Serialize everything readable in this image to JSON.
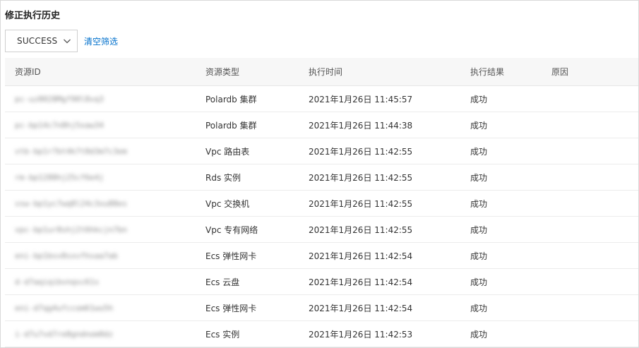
{
  "panel": {
    "title": "修正执行历史"
  },
  "filter": {
    "status_value": "SUCCESS",
    "clear_label": "清空筛选"
  },
  "table": {
    "columns": [
      "资源ID",
      "资源类型",
      "执行时间",
      "执行结果",
      "原因"
    ],
    "rows": [
      {
        "resource_id": "pc-uz8028Mgf90l8vq3",
        "type": "Polardb 集群",
        "time": "2021年1月26日 11:45:57",
        "result": "成功",
        "reason": ""
      },
      {
        "resource_id": "pc-bp14c7n8hj5xaw34",
        "type": "Polardb 集群",
        "time": "2021年1月26日 11:44:38",
        "result": "成功",
        "reason": ""
      },
      {
        "resource_id": "vtb-bp1r7bt4k7t8d3m7c3em",
        "type": "Vpc 路由表",
        "time": "2021年1月26日 11:42:55",
        "result": "成功",
        "reason": ""
      },
      {
        "resource_id": "rm-bp1288hj25cf6e4j",
        "type": "Rds 实例",
        "time": "2021年1月26日 11:42:55",
        "result": "成功",
        "reason": ""
      },
      {
        "resource_id": "vsw-bp1yc7wq8l24c3xu88es",
        "type": "Vpc 交换机",
        "time": "2021年1月26日 11:42:55",
        "result": "成功",
        "reason": ""
      },
      {
        "resource_id": "vpc-bp1ur8shj2t6hkcjn7bn",
        "type": "Vpc 专有网络",
        "time": "2021年1月26日 11:42:55",
        "result": "成功",
        "reason": ""
      },
      {
        "resource_id": "eni-bp1bsv8sxvfhsaa7ab",
        "type": "Ecs 弹性网卡",
        "time": "2021年1月26日 11:42:54",
        "result": "成功",
        "reason": ""
      },
      {
        "resource_id": "d-d7aqiqibvnqsc61s",
        "type": "Ecs 云盘",
        "time": "2021年1月26日 11:42:54",
        "result": "成功",
        "reason": ""
      },
      {
        "resource_id": "eni-d7qg4ufccom61wu5h",
        "type": "Ecs 弹性网卡",
        "time": "2021年1月26日 11:42:54",
        "result": "成功",
        "reason": ""
      },
      {
        "resource_id": "i-d7u7vd7re8gndnom0dz",
        "type": "Ecs 实例",
        "time": "2021年1月26日 11:42:53",
        "result": "成功",
        "reason": ""
      }
    ]
  },
  "colors": {
    "link": "#0070cc",
    "header_bg": "#f7f7f7",
    "border": "#d9d9d9"
  },
  "icons": {
    "select_arrow": "chevron-down-icon"
  }
}
